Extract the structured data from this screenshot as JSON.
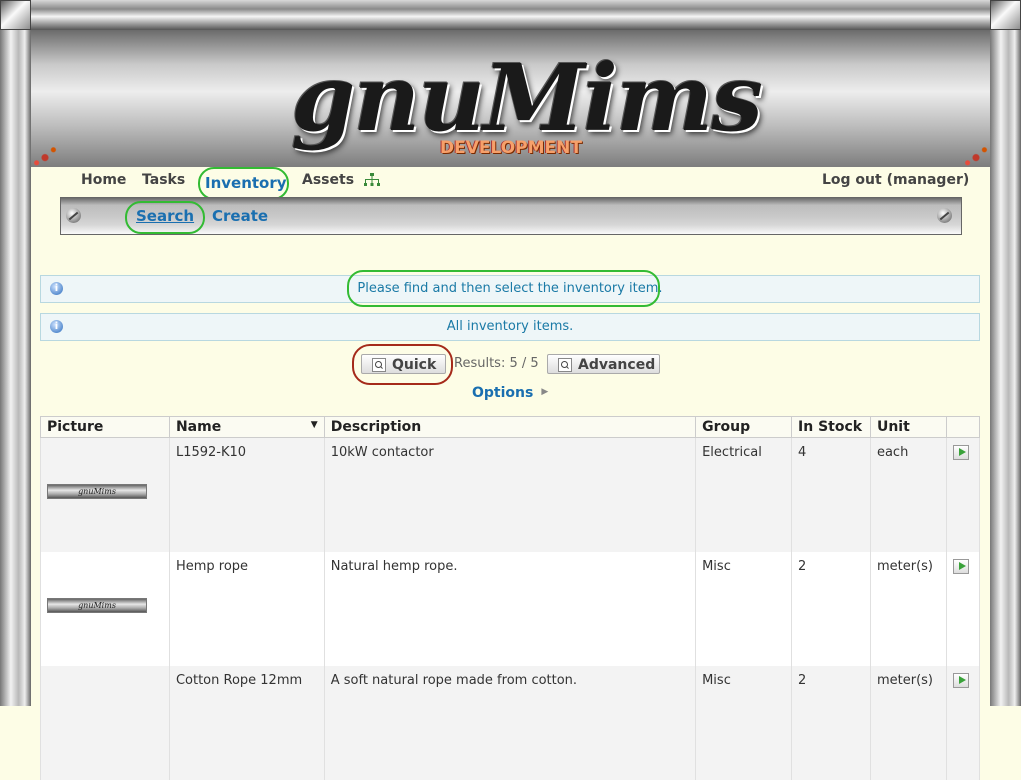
{
  "logo": {
    "title": "gnuMims",
    "subtitle": "DEVELOPMENT"
  },
  "nav": {
    "home": "Home",
    "tasks": "Tasks",
    "inventory": "Inventory",
    "assets": "Assets",
    "logout": "Log out (manager)"
  },
  "subnav": {
    "search": "Search",
    "create": "Create"
  },
  "messages": {
    "instruction": "Please find and then select the inventory item.",
    "filter": "All inventory items."
  },
  "search": {
    "quick_label": "Quick",
    "results": "Results: 5 / 5",
    "advanced_label": "Advanced",
    "options_label": "Options"
  },
  "table": {
    "columns": [
      "Picture",
      "Name",
      "Description",
      "Group",
      "In Stock",
      "Unit",
      ""
    ],
    "rows": [
      {
        "picture": "gnuMims",
        "name": "L1592-K10",
        "description": "10kW contactor",
        "group": "Electrical",
        "in_stock": "4",
        "unit": "each"
      },
      {
        "picture": "gnuMims",
        "name": "Hemp rope",
        "description": "Natural hemp rope.",
        "group": "Misc",
        "in_stock": "2",
        "unit": "meter(s)"
      },
      {
        "picture": "",
        "name": "Cotton Rope 12mm",
        "description": "A soft natural rope made from cotton.",
        "group": "Misc",
        "in_stock": "2",
        "unit": "meter(s)"
      }
    ]
  },
  "colors": {
    "link": "#1a6fb0",
    "highlight_green": "#33bb33",
    "highlight_red": "#a52a1a",
    "page_bg": "#fdfde6"
  }
}
